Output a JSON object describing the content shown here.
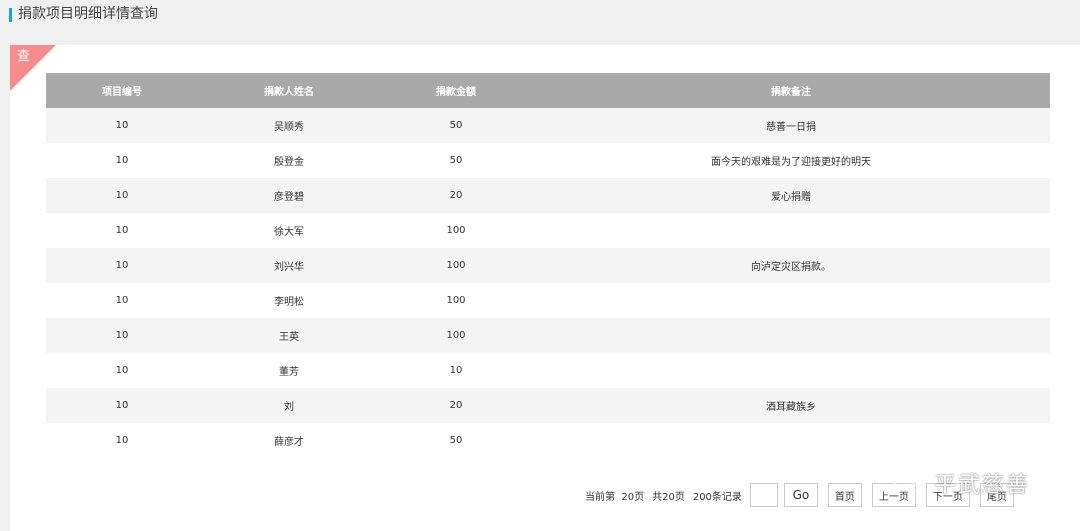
{
  "header": {
    "title": "捐款项目明细详情查询"
  },
  "panel": {
    "tag": "查"
  },
  "table": {
    "columns": [
      "项目编号",
      "捐款人姓名",
      "捐款金额",
      "捐款备注"
    ],
    "rows": [
      [
        "10",
        "吴顺秀",
        "50",
        "慈善一日捐"
      ],
      [
        "10",
        "殷登金",
        "50",
        "面今天的艰难是为了迎接更好的明天"
      ],
      [
        "10",
        "彦登碧",
        "20",
        "爱心捐赠"
      ],
      [
        "10",
        "徐大军",
        "100",
        ""
      ],
      [
        "10",
        "刘兴华",
        "100",
        "向泸定灾区捐款。"
      ],
      [
        "10",
        "李明松",
        "100",
        ""
      ],
      [
        "10",
        "王英",
        "100",
        ""
      ],
      [
        "10",
        "董芳",
        "10",
        ""
      ],
      [
        "10",
        "刘",
        "20",
        "酒耳藏族乡"
      ],
      [
        "10",
        "薛彦才",
        "50",
        ""
      ]
    ]
  },
  "pager": {
    "current": "当前第  20页",
    "total_pages": "共20页",
    "total_records": "200条记录",
    "jump_value": "",
    "go_label": "Go",
    "first_label": "首页",
    "prev_label": "上一页",
    "next_label": "下一页",
    "last_label": "尾页"
  },
  "watermark": {
    "text": "平武慈善",
    "icon": "wechat-icon"
  }
}
